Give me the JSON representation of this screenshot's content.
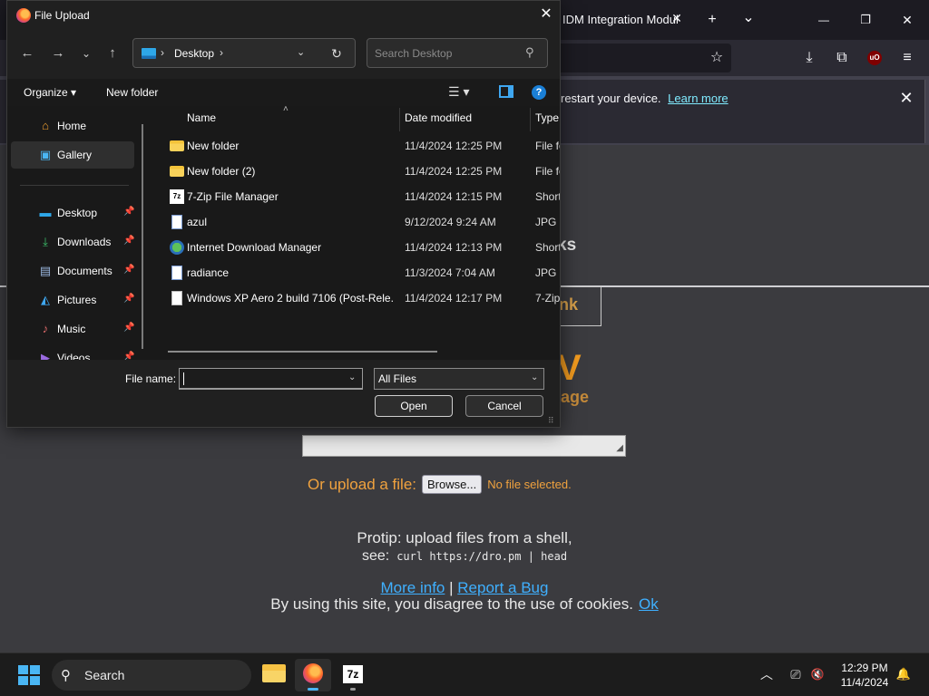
{
  "browser": {
    "tab_title": "IDM Integration Modul",
    "tab_close": "✕",
    "new_tab": "+",
    "tab_list": "⌄",
    "min": "—",
    "restore": "❐",
    "close": "✕",
    "nav_icons": {
      "bookmark": "☆",
      "download": "⤓",
      "extensions": "⧉",
      "ublock": "uO",
      "menu": "≡"
    },
    "notification": {
      "text": "restart your device.",
      "link": "Learn more",
      "close": "✕"
    }
  },
  "page": {
    "partial_heading": "ks",
    "partial_box": "nk",
    "partial_v": "V",
    "partial_age": "age",
    "upload_label": "Or upload a file:",
    "browse": "Browse...",
    "no_file": "No file selected.",
    "protip": "Protip: upload files from a shell,",
    "see": "see:",
    "command": "curl https://dro.pm | head",
    "more_info": "More info",
    "separator": "|",
    "report_bug": "Report a Bug",
    "cookie_text": "By using this site, you disagree to the use of cookies.",
    "ok": "Ok"
  },
  "dialog": {
    "title": "File Upload",
    "close": "✕",
    "nav": {
      "back": "←",
      "forward": "→",
      "recent": "⌄",
      "up": "↑"
    },
    "address": {
      "sep_left": "›",
      "location": "Desktop",
      "sep_right": "›",
      "dropdown": "⌄",
      "refresh": "↻"
    },
    "search_placeholder": "Search Desktop",
    "search_icon": "⚲",
    "commands": {
      "organize": "Organize ▾",
      "new_folder": "New folder",
      "view": "☰ ▾",
      "help": "?"
    },
    "nav_pane": [
      {
        "label": "Home",
        "icon": "home-icon",
        "glyph": "⌂",
        "color": "#f0a030",
        "pinned": false,
        "selected": false
      },
      {
        "label": "Gallery",
        "icon": "gallery-icon",
        "glyph": "▣",
        "color": "#4ab6f4",
        "pinned": false,
        "selected": true
      },
      {
        "label": "Desktop",
        "icon": "desktop-icon",
        "glyph": "▬",
        "color": "#2ea7e8",
        "pinned": true,
        "selected": false
      },
      {
        "label": "Downloads",
        "icon": "download-icon",
        "glyph": "⤓",
        "color": "#3cc06a",
        "pinned": true,
        "selected": false
      },
      {
        "label": "Documents",
        "icon": "documents-icon",
        "glyph": "▤",
        "color": "#9ab8e0",
        "pinned": true,
        "selected": false
      },
      {
        "label": "Pictures",
        "icon": "pictures-icon",
        "glyph": "◭",
        "color": "#3fa7f0",
        "pinned": true,
        "selected": false
      },
      {
        "label": "Music",
        "icon": "music-icon",
        "glyph": "♪",
        "color": "#e06a6a",
        "pinned": true,
        "selected": false
      },
      {
        "label": "Videos",
        "icon": "videos-icon",
        "glyph": "▶",
        "color": "#9a6ae0",
        "pinned": true,
        "selected": false
      }
    ],
    "pin_glyph": "📌",
    "columns": {
      "name": "Name",
      "date": "Date modified",
      "type": "Type",
      "sort_arrow": "˄"
    },
    "files": [
      {
        "name": "New folder",
        "date": "11/4/2024 12:25 PM",
        "type": "File fo",
        "icon": "folder"
      },
      {
        "name": "New folder (2)",
        "date": "11/4/2024 12:25 PM",
        "type": "File fo",
        "icon": "folder"
      },
      {
        "name": "7-Zip File Manager",
        "date": "11/4/2024 12:15 PM",
        "type": "Short",
        "icon": "7z"
      },
      {
        "name": "azul",
        "date": "9/12/2024 9:24 AM",
        "type": "JPG F",
        "icon": "jpg"
      },
      {
        "name": "Internet Download Manager",
        "date": "11/4/2024 12:13 PM",
        "type": "Short",
        "icon": "idm"
      },
      {
        "name": "radiance",
        "date": "11/3/2024 7:04 AM",
        "type": "JPG F",
        "icon": "jpg"
      },
      {
        "name": "Windows XP Aero 2 build 7106 (Post-Rele...",
        "date": "11/4/2024 12:17 PM",
        "type": "7-Zip",
        "icon": "doc"
      }
    ],
    "file_name_label": "File name:",
    "file_name_value": "",
    "file_type": "All Files",
    "dropdown": "⌄",
    "open": "Open",
    "cancel": "Cancel",
    "grip": "⠿"
  },
  "taskbar": {
    "search": "Search",
    "search_icon": "⚲",
    "seven_zip": "7z",
    "tray_chevron": "︿",
    "tray_network": "⎚",
    "tray_volume": "🔇",
    "tray_bell": "🔔",
    "time": "12:29 PM",
    "date": "11/4/2024"
  }
}
